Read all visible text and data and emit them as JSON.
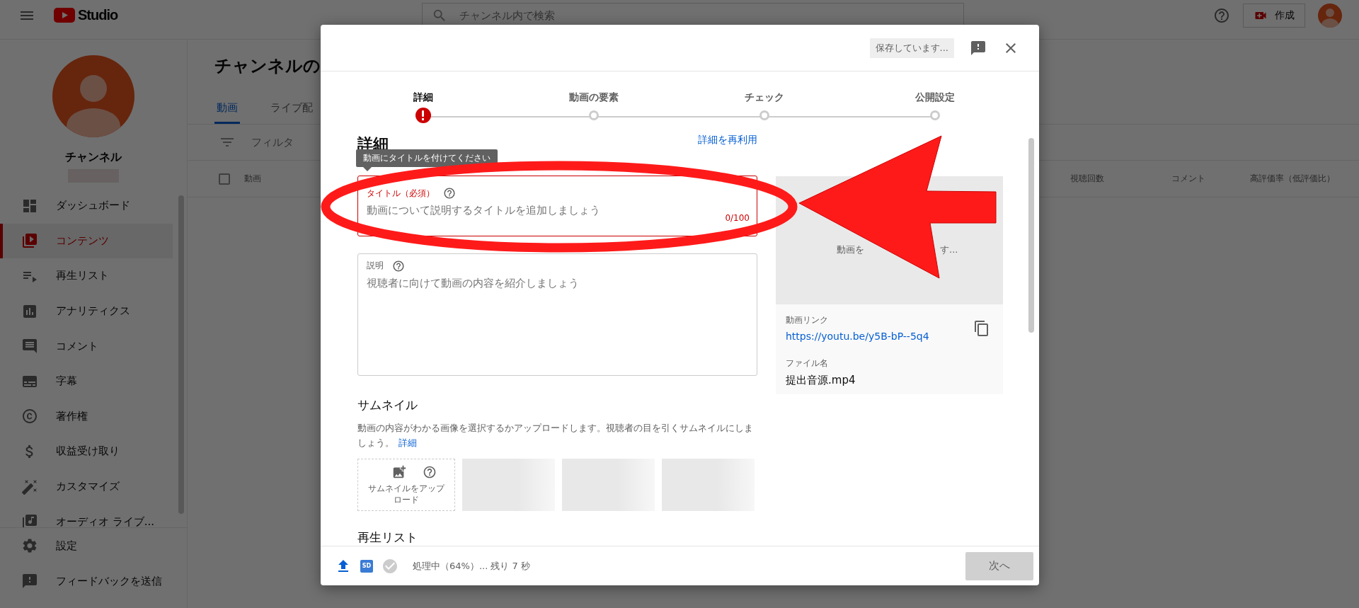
{
  "topbar": {
    "logo_text": "Studio",
    "search": {
      "placeholder": "チャンネル内で検索"
    },
    "create_button": "作成"
  },
  "sidebar": {
    "channel_name": "チャンネル",
    "items": [
      {
        "label": "ダッシュボード",
        "selected": false
      },
      {
        "label": "コンテンツ",
        "selected": true
      },
      {
        "label": "再生リスト",
        "selected": false
      },
      {
        "label": "アナリティクス",
        "selected": false
      },
      {
        "label": "コメント",
        "selected": false
      },
      {
        "label": "字幕",
        "selected": false
      },
      {
        "label": "著作権",
        "selected": false
      },
      {
        "label": "収益受け取り",
        "selected": false
      },
      {
        "label": "カスタマイズ",
        "selected": false
      },
      {
        "label": "オーディオ ライブ...",
        "selected": false
      }
    ],
    "footer_items": [
      {
        "label": "設定"
      },
      {
        "label": "フィードバックを送信"
      }
    ]
  },
  "main": {
    "title": "チャンネルの",
    "tabs": [
      {
        "label": "動画",
        "selected": true
      },
      {
        "label": "ライブ配",
        "selected": false
      }
    ],
    "filter": {
      "placeholder": "フィルタ"
    },
    "table": {
      "select_all": {
        "checked": false
      },
      "columns": [
        "動画",
        "視聴回数",
        "コメント",
        "高評価率（低評価比）"
      ]
    }
  },
  "dialog": {
    "status_chip": "保存しています...",
    "steps": [
      {
        "label": "詳細",
        "error": true
      },
      {
        "label": "動画の要素",
        "error": false
      },
      {
        "label": "チェック",
        "error": false
      },
      {
        "label": "公開設定",
        "error": false
      }
    ],
    "section_title": "詳細",
    "reuse_link": "詳細を再利用",
    "tooltip": "動画にタイトルを付けてください",
    "title_field": {
      "label": "タイトル（必須）",
      "placeholder": "動画について説明するタイトルを追加しましょう",
      "counter": "0/100",
      "error": true
    },
    "description_field": {
      "label": "説明",
      "placeholder": "視聴者に向けて動画の内容を紹介しましょう"
    },
    "thumbnail": {
      "heading": "サムネイル",
      "text": "動画の内容がわかる画像を選択するかアップロードします。視聴者の目を引くサムネイルにしましょう。",
      "link": "詳細",
      "upload_label": "サムネイルをアップロード"
    },
    "playlist_heading": "再生リスト",
    "preview": {
      "text_parts": [
        "動画を",
        "す..."
      ],
      "link_label": "動画リンク",
      "link": "https://youtu.be/y5B-bP--5q4",
      "file_label": "ファイル名",
      "file_name": "提出音源.mp4"
    },
    "footer": {
      "sd_badge": "SD",
      "status": "処理中（64%）... 残り 7 秒",
      "next_button": {
        "label": "次へ",
        "disabled": true
      }
    }
  }
}
